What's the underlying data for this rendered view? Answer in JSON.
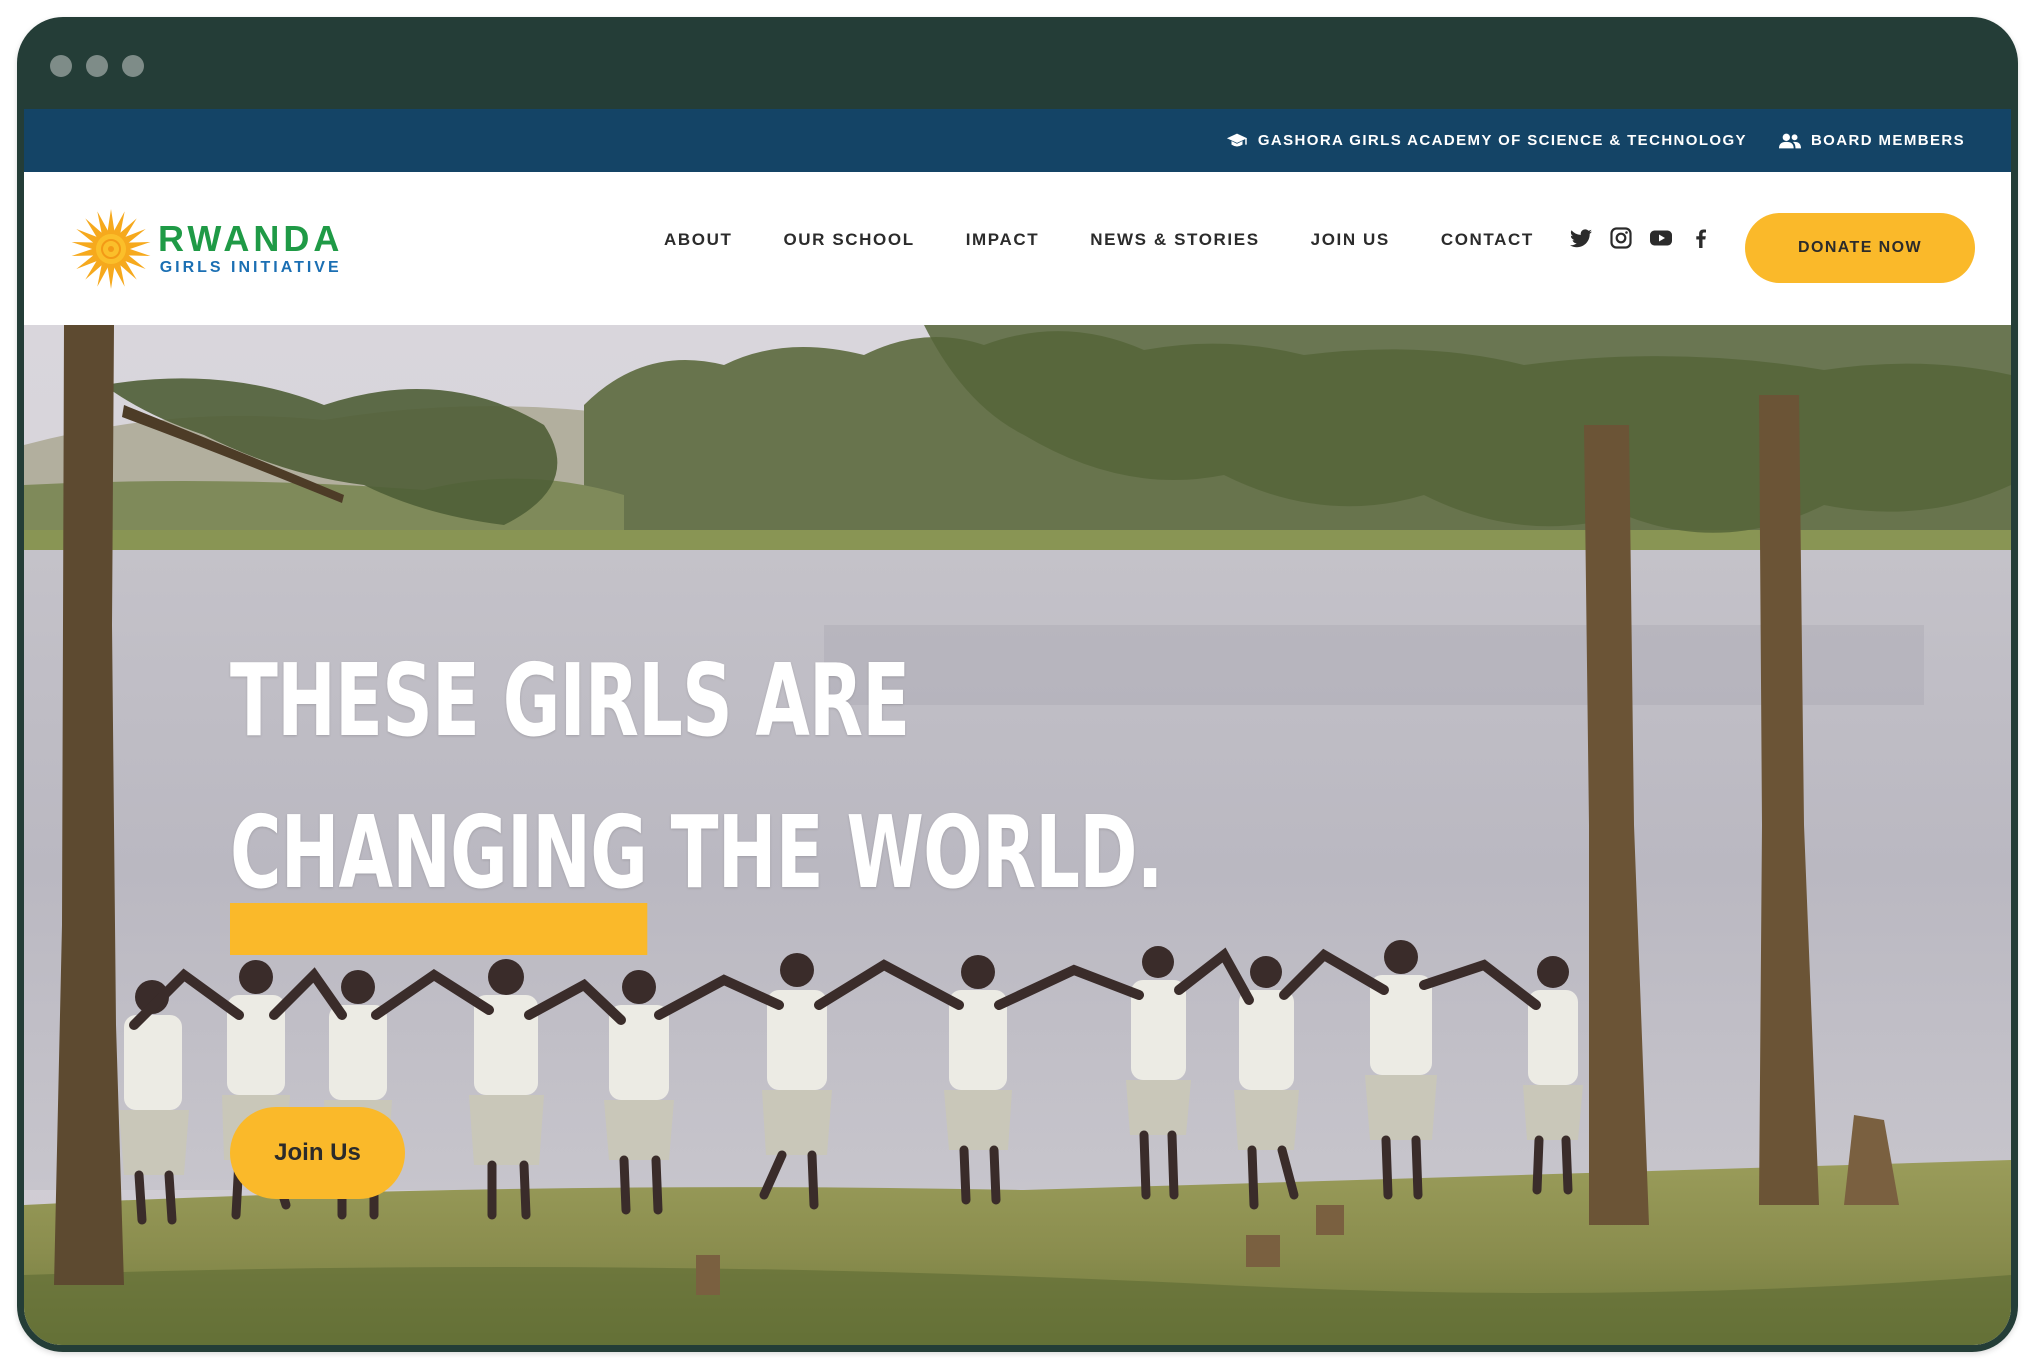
{
  "utility_bar": {
    "academy_link": "GASHORA GIRLS ACADEMY OF SCIENCE & TECHNOLOGY",
    "board_link": "BOARD MEMBERS"
  },
  "logo": {
    "main": "RWANDA",
    "sub": "GIRLS INITIATIVE"
  },
  "nav": {
    "items": [
      {
        "label": "ABOUT"
      },
      {
        "label": "OUR SCHOOL"
      },
      {
        "label": "IMPACT"
      },
      {
        "label": "NEWS & STORIES"
      },
      {
        "label": "JOIN US"
      },
      {
        "label": "CONTACT"
      }
    ]
  },
  "social": [
    "twitter-icon",
    "instagram-icon",
    "youtube-icon",
    "facebook-icon"
  ],
  "donate_label": "DONATE NOW",
  "hero": {
    "line1": "THESE GIRLS ARE",
    "line2_highlight": "CHANGING",
    "line2_rest": " THE WORLD.",
    "cta": "Join Us"
  },
  "colors": {
    "frame": "#243d37",
    "utility_bar": "#144466",
    "accent": "#fab92a",
    "logo_green": "#1f9a46",
    "logo_blue": "#1b6fb3"
  }
}
